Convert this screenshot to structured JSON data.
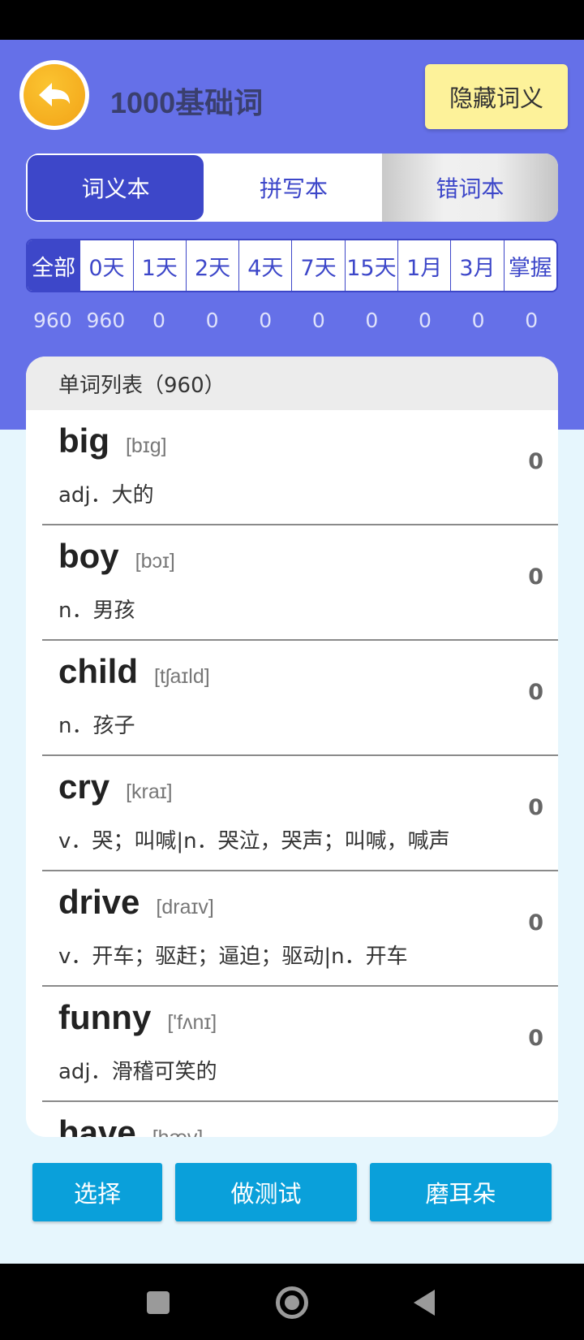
{
  "header": {
    "title": "1000基础词",
    "hide_button": "隐藏词义"
  },
  "tabs": [
    {
      "label": "词义本",
      "active": true
    },
    {
      "label": "拼写本",
      "active": false
    },
    {
      "label": "错词本",
      "active": false
    }
  ],
  "day_filters": [
    {
      "label": "全部",
      "count": "960"
    },
    {
      "label": "0天",
      "count": "960"
    },
    {
      "label": "1天",
      "count": "0"
    },
    {
      "label": "2天",
      "count": "0"
    },
    {
      "label": "4天",
      "count": "0"
    },
    {
      "label": "7天",
      "count": "0"
    },
    {
      "label": "15天",
      "count": "0"
    },
    {
      "label": "1月",
      "count": "0"
    },
    {
      "label": "3月",
      "count": "0"
    },
    {
      "label": "掌握",
      "count": "0"
    }
  ],
  "word_list": {
    "header": "单词列表（960）",
    "items": [
      {
        "word": "big",
        "phonetic": "[bɪg]",
        "meaning": "adj．大的",
        "count": "0"
      },
      {
        "word": "boy",
        "phonetic": "[bɔɪ]",
        "meaning": "n．男孩",
        "count": "0"
      },
      {
        "word": "child",
        "phonetic": "[tʃaɪld]",
        "meaning": "n．孩子",
        "count": "0"
      },
      {
        "word": "cry",
        "phonetic": "[kraɪ]",
        "meaning": "v．哭；叫喊|n．哭泣，哭声；叫喊，喊声",
        "count": "0"
      },
      {
        "word": "drive",
        "phonetic": "[draɪv]",
        "meaning": "v．开车；驱赶；逼迫；驱动|n．开车",
        "count": "0"
      },
      {
        "word": "funny",
        "phonetic": "['fʌnɪ]",
        "meaning": "adj．滑稽可笑的",
        "count": "0"
      },
      {
        "word": "have",
        "phonetic": "[hæv]",
        "meaning": "",
        "count": ""
      }
    ]
  },
  "actions": {
    "select": "选择",
    "test": "做测试",
    "listen": "磨耳朵"
  },
  "colors": {
    "primary": "#3d47c9",
    "header_bg": "#6570e8",
    "action_blue": "#0aa0da",
    "hide_button_bg": "#fdf29a"
  }
}
